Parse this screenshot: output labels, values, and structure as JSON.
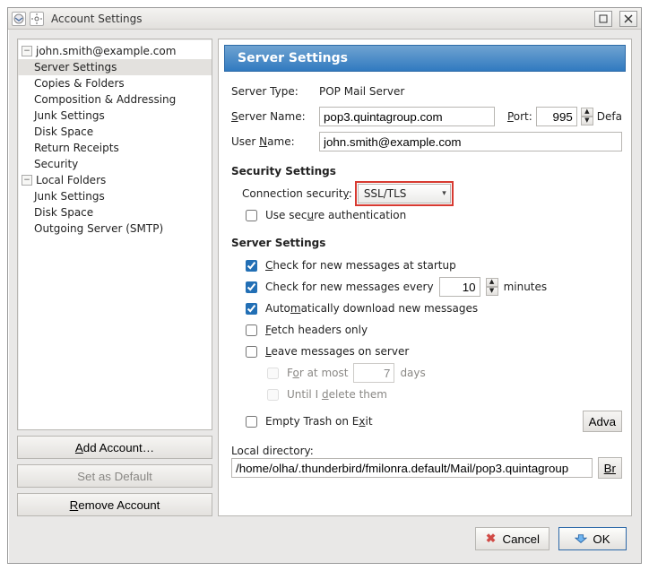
{
  "window": {
    "title": "Account Settings"
  },
  "tree": {
    "account": "john.smith@example.com",
    "items": [
      "Server Settings",
      "Copies & Folders",
      "Composition & Addressing",
      "Junk Settings",
      "Disk Space",
      "Return Receipts",
      "Security"
    ],
    "local_folders": "Local Folders",
    "local_items": [
      "Junk Settings",
      "Disk Space"
    ],
    "outgoing": "Outgoing Server (SMTP)"
  },
  "side_buttons": {
    "add": "Add Account…",
    "default": "Set as Default",
    "remove": "Remove Account"
  },
  "panel": {
    "header": "Server Settings",
    "server_type_label": "Server Type:",
    "server_type_value": "POP Mail Server",
    "server_name_label": "Server Name:",
    "server_name_value": "pop3.quintagroup.com",
    "port_label": "Port:",
    "port_value": "995",
    "port_default_label": "Defa",
    "user_name_label": "User Name:",
    "user_name_value": "john.smith@example.com",
    "security_heading": "Security Settings",
    "conn_sec_label": "Connection security:",
    "conn_sec_value": "SSL/TLS",
    "use_secure_auth": "Use secure authentication",
    "server_settings_heading": "Server Settings",
    "check_startup": "Check for new messages at startup",
    "check_every_pre": "Check for new messages every",
    "check_every_val": "10",
    "check_every_post": "minutes",
    "auto_download": "Automatically download new messages",
    "fetch_headers": "Fetch headers only",
    "leave_server": "Leave messages on server",
    "for_at_most_pre": "For at most",
    "for_at_most_val": "7",
    "for_at_most_post": "days",
    "until_delete": "Until I delete them",
    "empty_trash": "Empty Trash on Exit",
    "advanced_btn": "Adva",
    "local_dir_label": "Local directory:",
    "local_dir_value": "/home/olha/.thunderbird/fmilonra.default/Mail/pop3.quintagroup",
    "browse_btn": "Br"
  },
  "dialog": {
    "cancel": "Cancel",
    "ok": "OK"
  }
}
